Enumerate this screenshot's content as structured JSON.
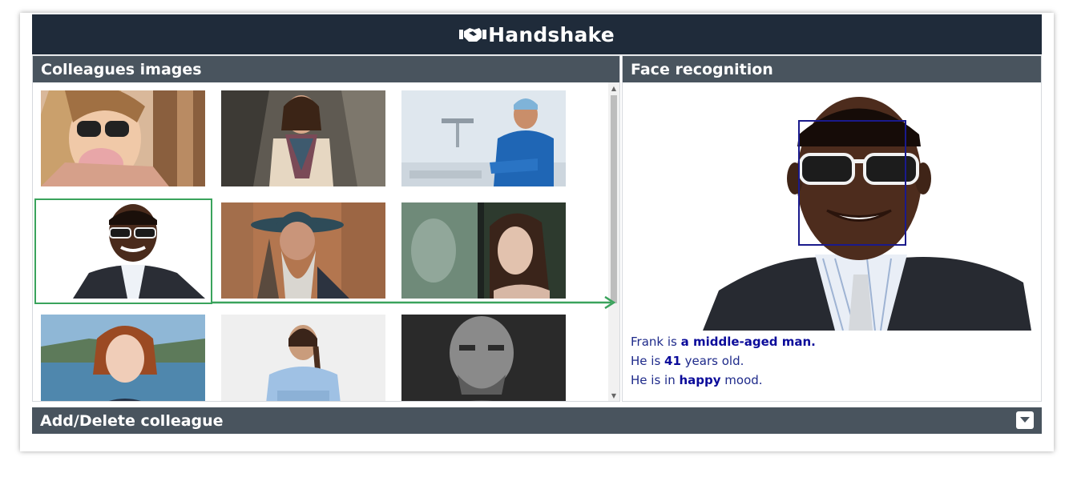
{
  "app": {
    "title": "Handshake",
    "logo_icon": "handshake-icon"
  },
  "colleagues_panel": {
    "title": "Colleagues images",
    "selected_index": 3,
    "thumbnails": [
      {
        "name": "thumb-woman-sunglasses"
      },
      {
        "name": "thumb-woman-scarf"
      },
      {
        "name": "thumb-surgeon"
      },
      {
        "name": "thumb-frank"
      },
      {
        "name": "thumb-bearded-man-hat"
      },
      {
        "name": "thumb-woman-window"
      },
      {
        "name": "thumb-redhead-woman"
      },
      {
        "name": "thumb-braided-woman"
      },
      {
        "name": "thumb-bald-man-bw"
      }
    ]
  },
  "face_panel": {
    "title": "Face recognition",
    "line1_prefix": "Frank is ",
    "line1_bold": "a middle-aged man.",
    "line2_prefix": "He is ",
    "line2_bold": "41",
    "line2_suffix": " years old.",
    "line3_prefix": "He is in ",
    "line3_bold": "happy",
    "line3_suffix": " mood."
  },
  "bottom": {
    "title": "Add/Delete colleague",
    "toggle_icon": "caret-down-icon"
  },
  "colors": {
    "header": "#1f2b3a",
    "panel_header": "#49545e",
    "selection": "#3aa35c",
    "face_box": "#1a1a8c",
    "info_text": "#1e2a8a"
  }
}
